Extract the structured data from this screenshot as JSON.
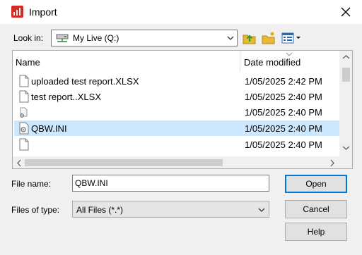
{
  "dialog": {
    "title": "Import"
  },
  "look_in": {
    "label": "Look in:",
    "value": "My Live (Q:)"
  },
  "file_list": {
    "columns": {
      "name": "Name",
      "date_modified": "Date modified"
    },
    "rows": [
      {
        "name": "uploaded test report.XLSX",
        "date": "1/05/2025 2:42 PM",
        "icon": "document-icon",
        "selected": false
      },
      {
        "name": "test report..XLSX",
        "date": "1/05/2025 2:40 PM",
        "icon": "document-icon",
        "selected": false
      },
      {
        "name": "",
        "date": "1/05/2025 2:40 PM",
        "icon": "config-file-icon",
        "selected": false
      },
      {
        "name": "QBW.INI",
        "date": "1/05/2025 2:40 PM",
        "icon": "settings-file-icon",
        "selected": true
      },
      {
        "name": "",
        "date": "1/05/2025 2:40 PM",
        "icon": "document-icon",
        "selected": false
      }
    ]
  },
  "file_name": {
    "label": "File name:",
    "value": "QBW.INI"
  },
  "files_of_type": {
    "label": "Files of type:",
    "value": "All Files (*.*)"
  },
  "buttons": {
    "open": "Open",
    "cancel": "Cancel",
    "help": "Help"
  },
  "colors": {
    "selection": "#cce8ff",
    "default_button_border": "#0078d7",
    "app_icon": "#d22a24"
  }
}
